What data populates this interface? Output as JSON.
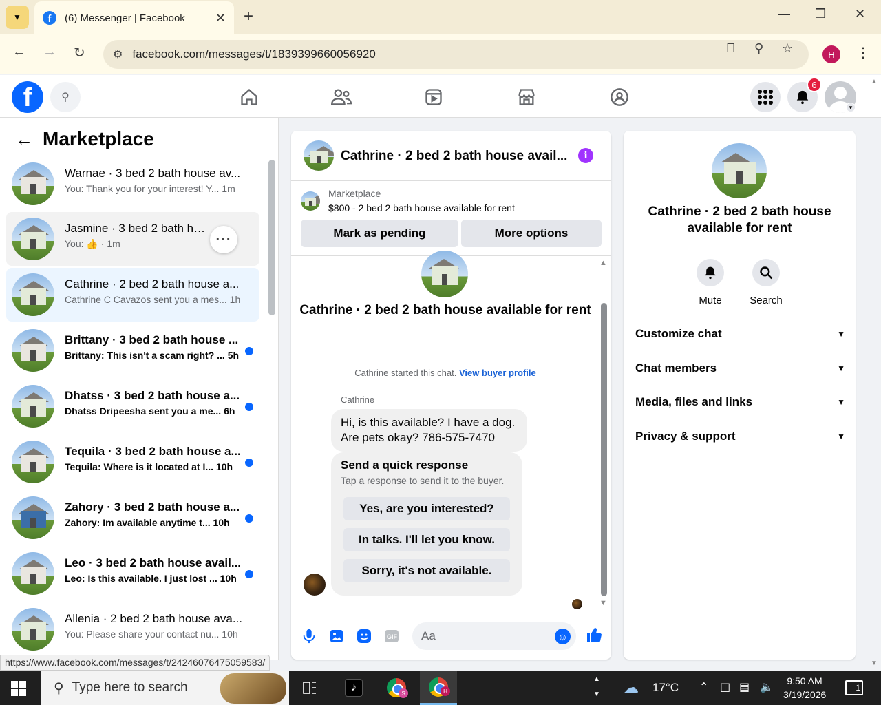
{
  "browser": {
    "tab_title": "(6) Messenger | Facebook",
    "url": "facebook.com/messages/t/1839399660056920",
    "profile_initial": "H",
    "status_url": "https://www.facebook.com/messages/t/24246076475059583/"
  },
  "fb_nav": {
    "notification_count": "6"
  },
  "sidebar": {
    "title": "Marketplace",
    "conversations": [
      {
        "name": "Warnae · 3 bed 2 bath house av...",
        "snippet": "You: Thank you for your interest! Y...",
        "time": "1m",
        "unread": false
      },
      {
        "name": "Jasmine · 3 bed 2 bath house...",
        "snippet": "You:",
        "time": "· 1m",
        "unread": false
      },
      {
        "name": "Cathrine · 2 bed 2 bath house a...",
        "snippet": "Cathrine C Cavazos sent you a mes...",
        "time": "1h",
        "unread": false
      },
      {
        "name": "Brittany · 3 bed 2 bath house ...",
        "snippet": "Brittany: This isn't a scam right? ...",
        "time": "5h",
        "unread": true
      },
      {
        "name": "Dhatss · 3 bed 2 bath house a...",
        "snippet": "Dhatss Dripeesha sent you a me...",
        "time": "6h",
        "unread": true
      },
      {
        "name": "Tequila · 3 bed 2 bath house a...",
        "snippet": "Tequila: Where is it located at I...",
        "time": "10h",
        "unread": true
      },
      {
        "name": "Zahory · 3 bed 2 bath house a...",
        "snippet": "Zahory: Im available anytime t...",
        "time": "10h",
        "unread": true
      },
      {
        "name": "Leo · 3 bed 2 bath house avail...",
        "snippet": "Leo: Is this available. I just lost ...",
        "time": "10h",
        "unread": true
      },
      {
        "name": "Allenia · 2 bed 2 bath house ava...",
        "snippet": "You: Please share your contact nu...",
        "time": "10h",
        "unread": false
      }
    ]
  },
  "chat": {
    "title": "Cathrine · 2 bed 2 bath house avail...",
    "marketplace_label": "Marketplace",
    "listing": "$800 - 2 bed 2 bath house available for rent",
    "mark_pending": "Mark as pending",
    "more_options": "More options",
    "big_title": "Cathrine · 2 bed 2 bath house available for rent",
    "started_text": "Cathrine started this chat.",
    "view_buyer_profile": "View buyer profile",
    "sender": "Cathrine",
    "message_line1": "Hi, is this available? I have a dog.",
    "message_line2": "Are pets okay? 786-575-7470",
    "quick_title": "Send a quick response",
    "quick_sub": "Tap a response to send it to the buyer.",
    "quick_responses": [
      "Yes, are you interested?",
      "In talks. I'll let you know.",
      "Sorry, it's not available."
    ],
    "composer_placeholder": "Aa"
  },
  "info_panel": {
    "title_line1": "Cathrine · 2 bed 2 bath house",
    "title_line2": "available for rent",
    "mute": "Mute",
    "search": "Search",
    "sections": [
      "Customize chat",
      "Chat members",
      "Media, files and links",
      "Privacy & support"
    ]
  },
  "taskbar": {
    "search_placeholder": "Type here to search",
    "temperature": "17°C",
    "time": "9:50 AM",
    "date": "3/19/2026",
    "notif_count": "1"
  }
}
